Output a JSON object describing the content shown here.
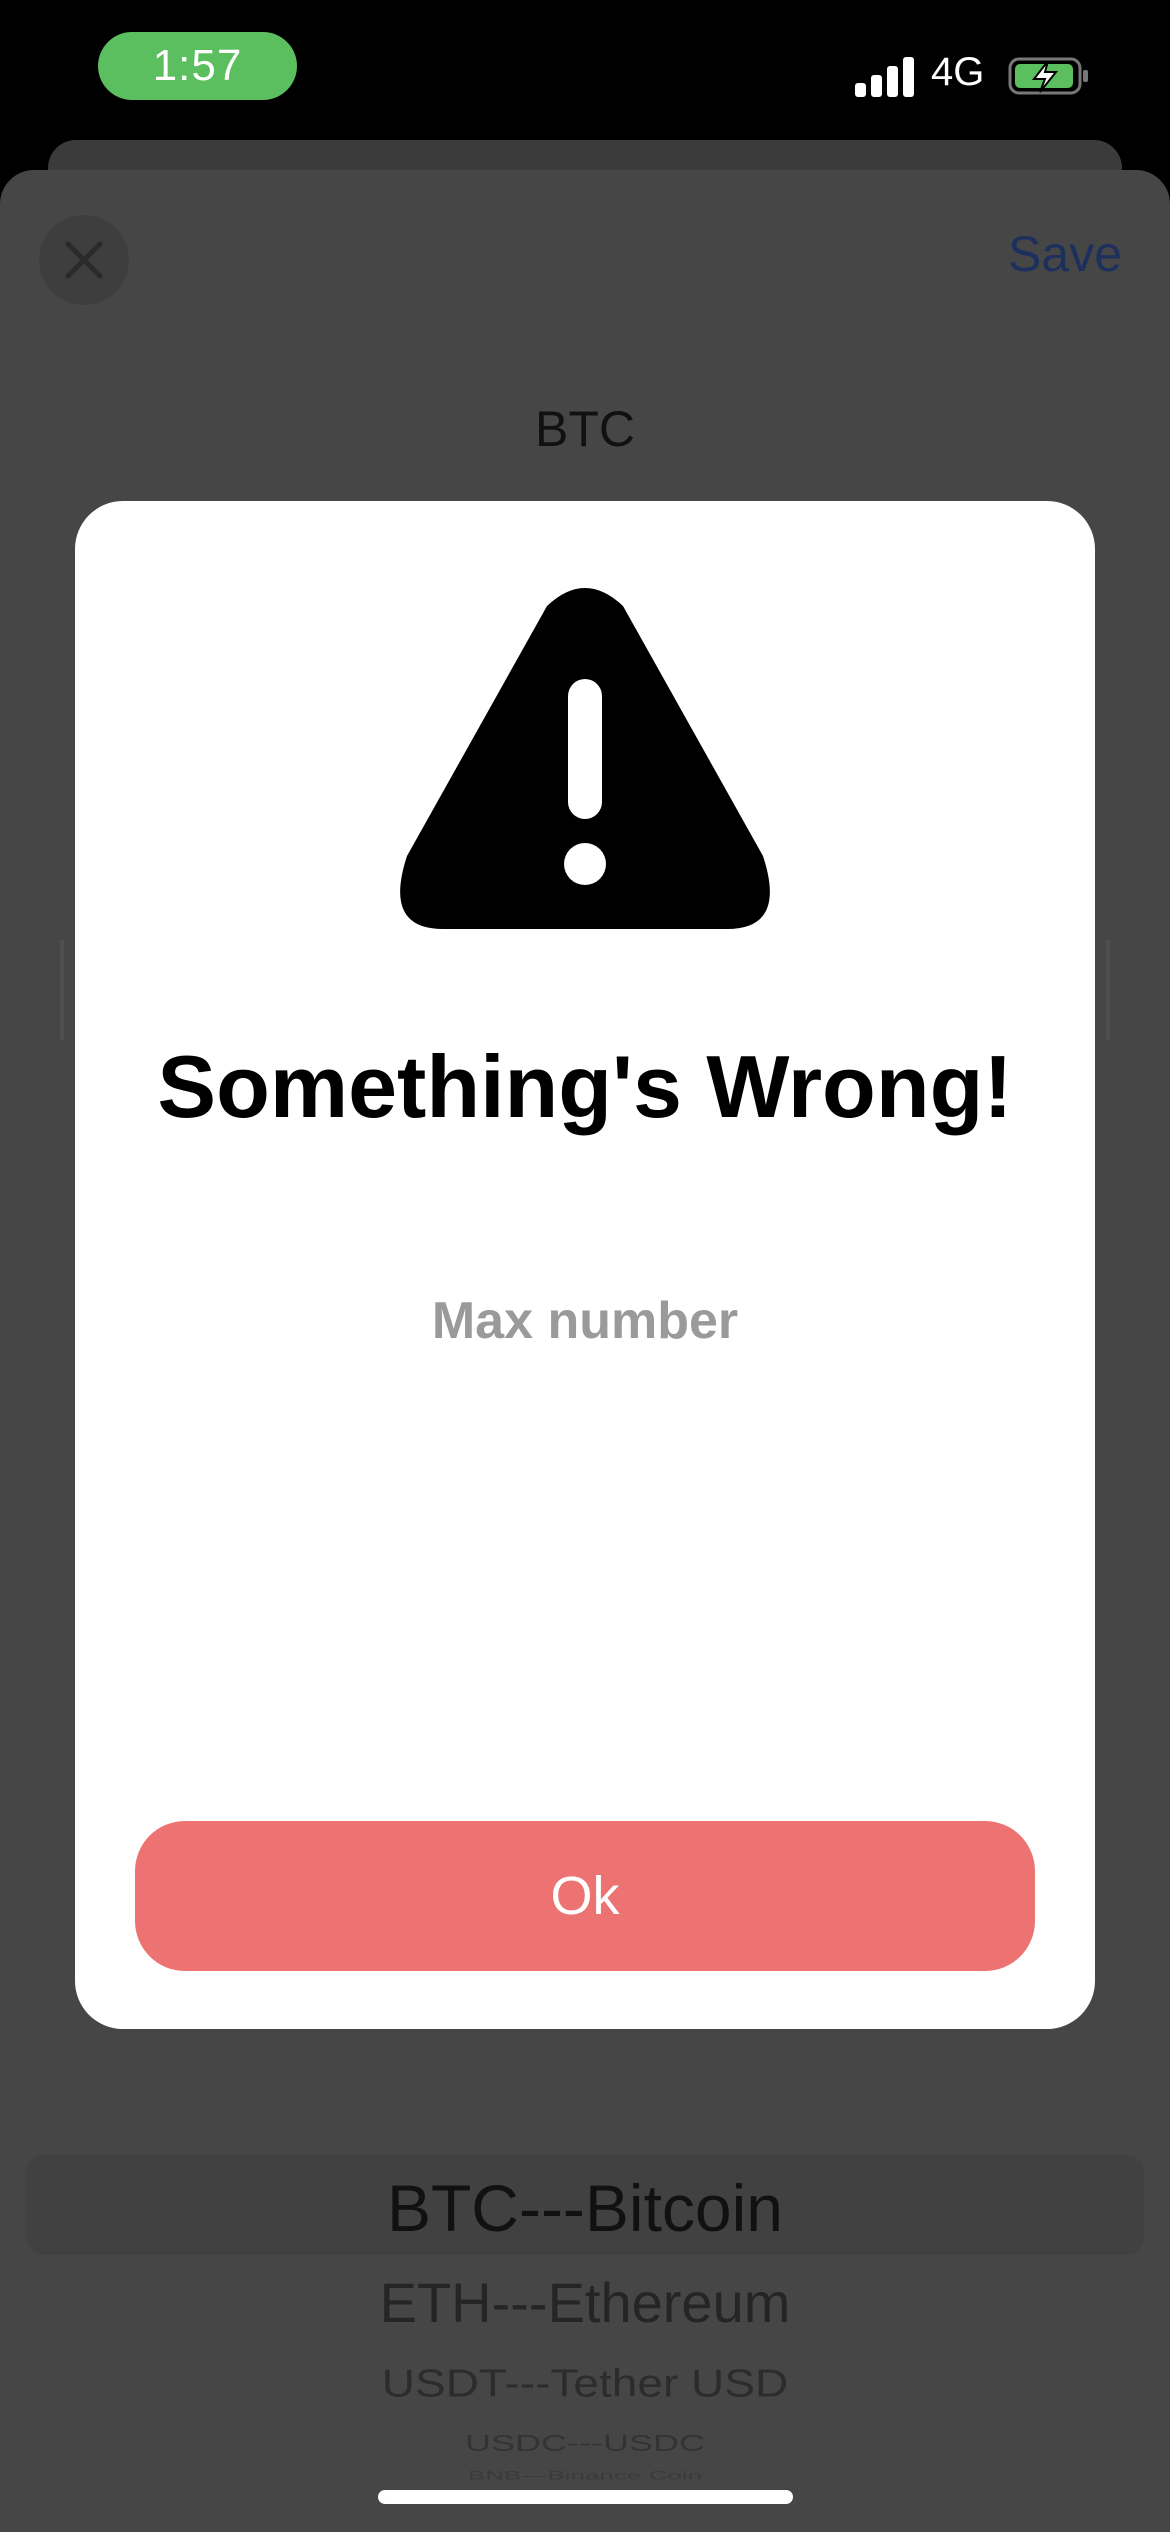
{
  "status_bar": {
    "time": "1:57",
    "network": "4G",
    "time_pill_color": "#5cbf5f"
  },
  "header": {
    "save_label": "Save",
    "coin_title": "BTC"
  },
  "dialog": {
    "title": "Something's Wrong!",
    "message": "Max number",
    "ok_label": "Ok",
    "ok_color": "#ec7372",
    "icon": "warning-triangle-icon"
  },
  "picker": {
    "items": [
      "BTC---Bitcoin",
      "ETH---Ethereum",
      "USDT---Tether USD",
      "USDC---USDC",
      "BNB---Binance Coin"
    ],
    "selected_index": 0
  }
}
